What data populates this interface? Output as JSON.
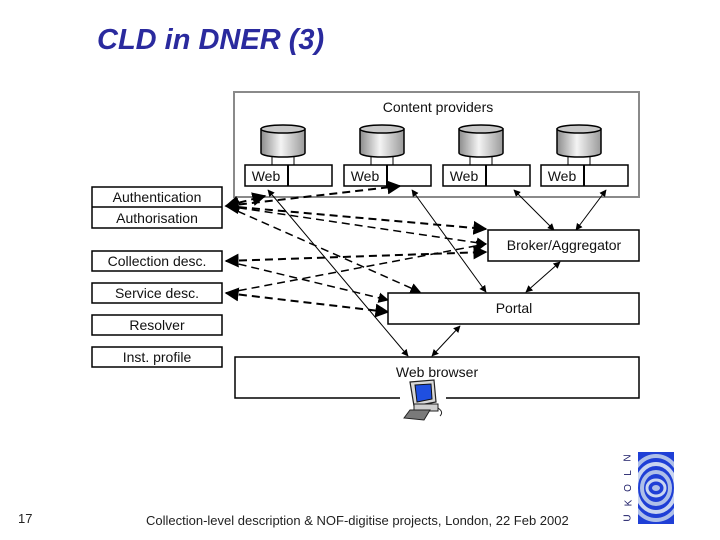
{
  "slide": {
    "title": "CLD in DNER (3)",
    "number": "17",
    "footer": "Collection-level description & NOF-digitise projects, London, 22 Feb 2002"
  },
  "logo": {
    "letters": [
      "N",
      "L",
      "O",
      "K",
      "U"
    ],
    "text_vertical": "UKOLN",
    "colors": {
      "primary": "#1f3fd6",
      "secondary": "#aebfe8"
    }
  },
  "diagram": {
    "content_providers": {
      "label": "Content providers",
      "servers": [
        {
          "label": "Web"
        },
        {
          "label": "Web"
        },
        {
          "label": "Web"
        },
        {
          "label": "Web"
        }
      ]
    },
    "services": [
      {
        "label": "Authentication"
      },
      {
        "label": "Authorisation"
      },
      {
        "label": "Collection desc."
      },
      {
        "label": "Service desc."
      },
      {
        "label": "Resolver"
      },
      {
        "label": "Inst. profile"
      }
    ],
    "broker": {
      "label": "Broker/Aggregator"
    },
    "portal": {
      "label": "Portal"
    },
    "browser": {
      "label": "Web browser"
    }
  },
  "colors": {
    "title": "#2a2a9e",
    "diagram_line": "#000000",
    "provider_border": "#8a8a8a",
    "screen": "#1f4fe0"
  }
}
